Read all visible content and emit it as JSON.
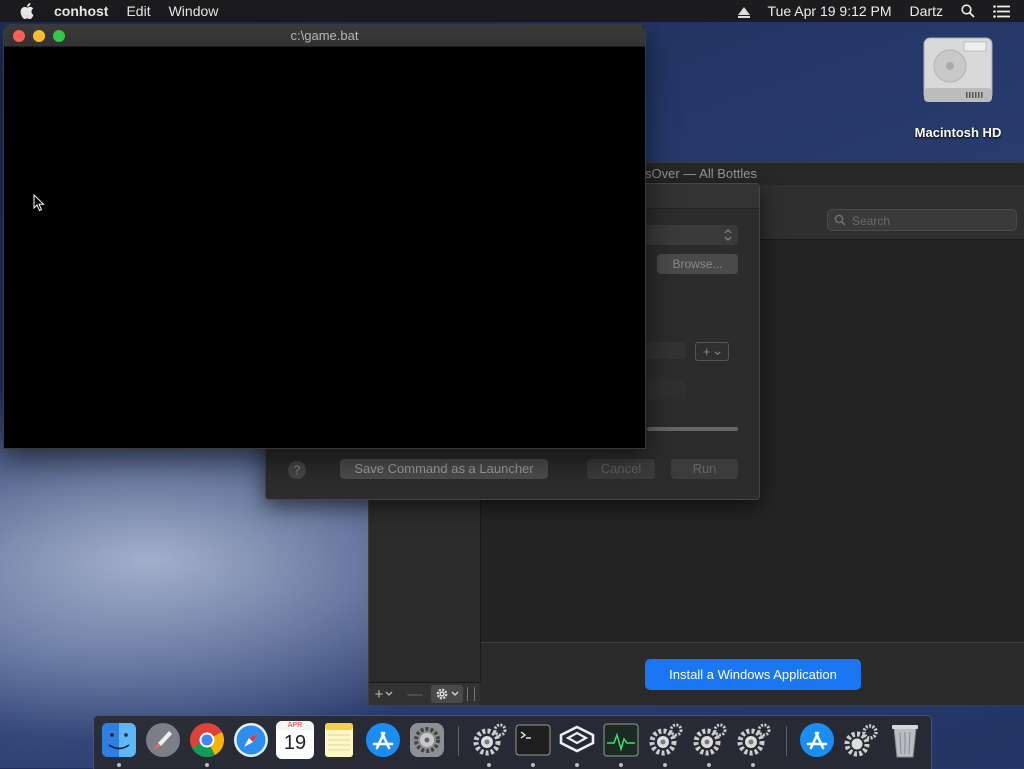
{
  "menubar": {
    "app_name": "conhost",
    "items": [
      "Edit",
      "Window"
    ],
    "clock": "Tue Apr 19  9:12 PM",
    "user": "Dartz"
  },
  "desktop": {
    "hd_label": "Macintosh HD"
  },
  "crossover": {
    "title": "CrossOver — All Bottles",
    "visible_title_fragment": "sOver — All Bottles",
    "search_placeholder": "Search",
    "install_button": "Install a Windows Application",
    "sidebar_add": "+",
    "sidebar_remove": "—"
  },
  "run_dialog": {
    "browse_button": "Browse...",
    "add_button": "+",
    "help_button": "?",
    "save_launcher_button": "Save Command as a Launcher",
    "cancel_button": "Cancel",
    "run_button": "Run"
  },
  "conhost": {
    "title": "c:\\game.bat"
  },
  "dock": {
    "calendar_month": "APR",
    "calendar_day": "19",
    "items": [
      "finder-icon",
      "launchpad-icon",
      "chrome-icon",
      "safari-icon",
      "calendar-icon",
      "notes-icon",
      "app-store-icon",
      "system-preferences-icon",
      "crossover-app-icon",
      "terminal-icon",
      "crossover-bottle-icon",
      "activity-monitor-icon",
      "crossover-app-icon-2",
      "crossover-app-icon-3",
      "crossover-app-icon-4",
      "app-store-downloads-icon",
      "crossover-files-icon",
      "trash-icon"
    ]
  }
}
